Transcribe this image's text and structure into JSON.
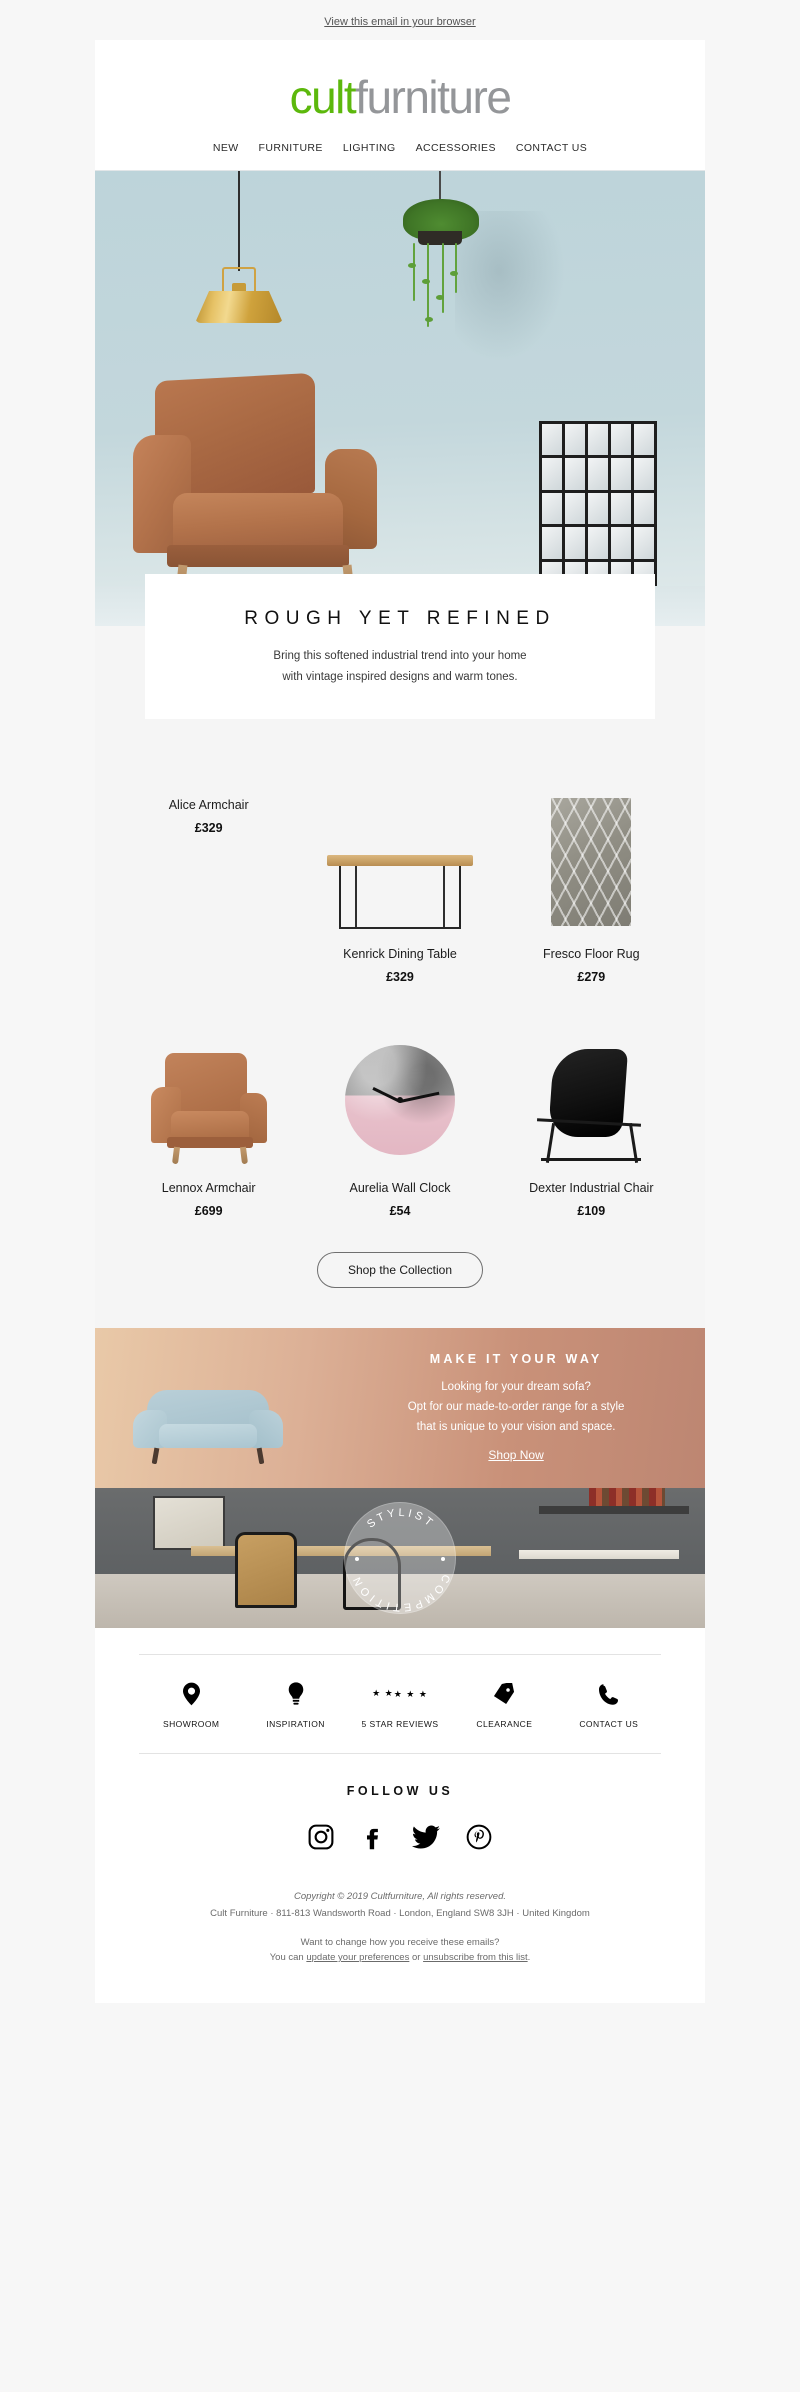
{
  "preheader": {
    "link_text": "View this email in your browser"
  },
  "header": {
    "logo_cult": "cult",
    "logo_furniture": "furniture",
    "logo_green": "#5cb80c",
    "logo_grey": "#949699",
    "nav": [
      {
        "label": "NEW"
      },
      {
        "label": "FURNITURE"
      },
      {
        "label": "LIGHTING"
      },
      {
        "label": "ACCESSORIES"
      },
      {
        "label": "CONTACT US"
      }
    ]
  },
  "hero": {
    "headline": "ROUGH YET REFINED",
    "subtext_line1": "Bring this softened industrial trend into your home",
    "subtext_line2": "with vintage inspired designs and warm tones.",
    "background_color": "#c3d7dc"
  },
  "products": {
    "row1": [
      {
        "name": "Alice Armchair",
        "price": "£329"
      },
      {
        "name": "Kenrick Dining Table",
        "price": "£329"
      },
      {
        "name": "Fresco Floor Rug",
        "price": "£279"
      }
    ],
    "row2": [
      {
        "name": "Lennox Armchair",
        "price": "£699"
      },
      {
        "name": "Aurelia Wall Clock",
        "price": "£54"
      },
      {
        "name": "Dexter Industrial Chair",
        "price": "£109"
      }
    ],
    "cta_label": "Shop the Collection"
  },
  "promo": {
    "title": "MAKE IT YOUR WAY",
    "line1": "Looking for your dream sofa?",
    "line2": "Opt for our made-to-order range for a style",
    "line3": "that is unique to your vision and space.",
    "link_label": "Shop Now",
    "gradient_start": "#e9c9a8",
    "gradient_end": "#bd8672"
  },
  "competition": {
    "badge_top": "STYLIST",
    "badge_bottom": "COMPETITION"
  },
  "value_props": [
    {
      "label": "SHOWROOM",
      "icon": "map-pin-icon"
    },
    {
      "label": "INSPIRATION",
      "icon": "lightbulb-icon"
    },
    {
      "label": "5 STAR REVIEWS",
      "icon": "stars-icon"
    },
    {
      "label": "CLEARANCE",
      "icon": "price-tag-icon"
    },
    {
      "label": "CONTACT US",
      "icon": "phone-icon"
    }
  ],
  "follow": {
    "title": "FOLLOW US",
    "socials": [
      {
        "name": "instagram-icon"
      },
      {
        "name": "facebook-icon"
      },
      {
        "name": "twitter-icon"
      },
      {
        "name": "pinterest-icon"
      }
    ]
  },
  "legal": {
    "copyright": "Copyright © 2019 Cultfurniture, All rights reserved.",
    "address": "Cult Furniture · 811-813 Wandsworth Road · London, England SW8 3JH · United Kingdom",
    "question": "Want to change how you receive these emails?",
    "pref_prefix": "You can ",
    "pref_link": "update your preferences",
    "pref_middle": " or ",
    "unsub_link": "unsubscribe from this list",
    "pref_suffix": "."
  }
}
